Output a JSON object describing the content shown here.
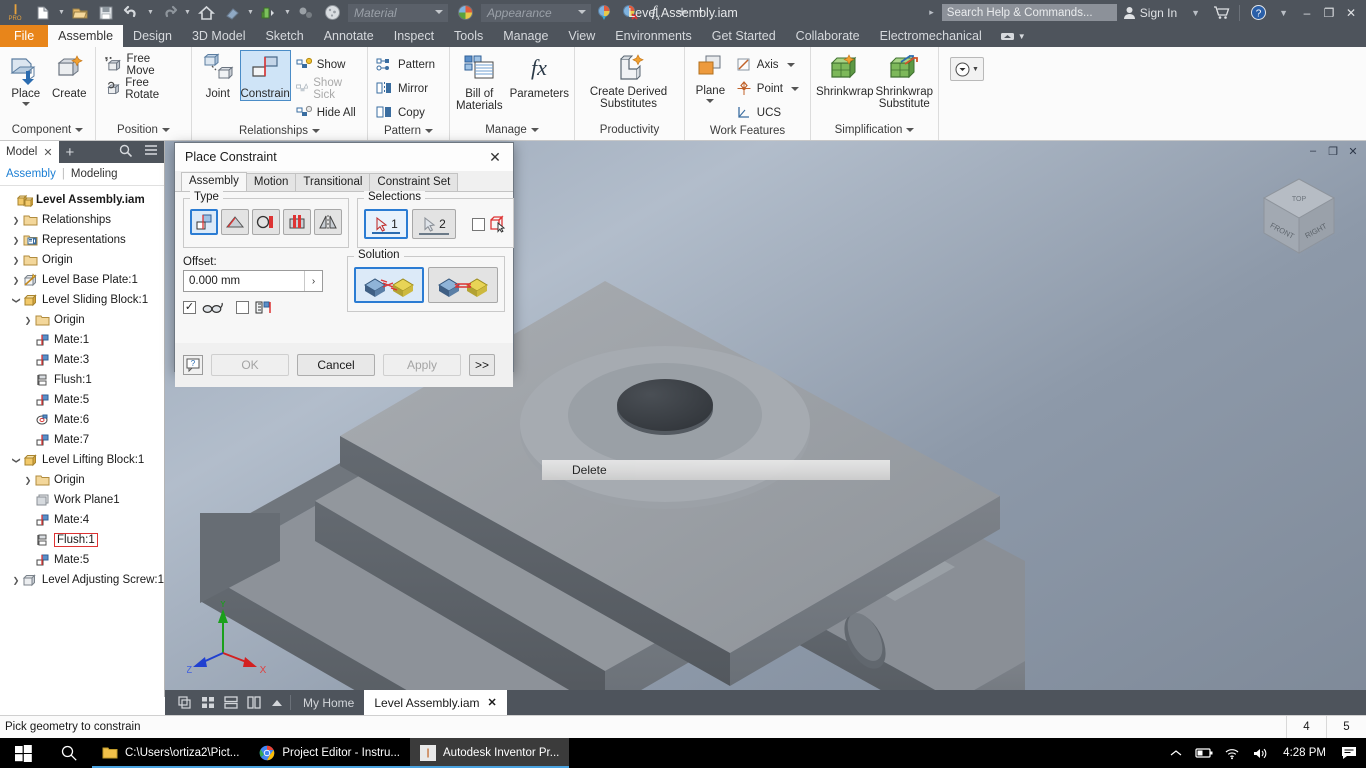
{
  "quick_access": {
    "logo": "I PRO",
    "buttons": [
      {
        "name": "new-file-icon",
        "label": "New"
      },
      {
        "name": "open-file-icon",
        "label": "Open"
      },
      {
        "name": "save-icon",
        "label": "Save"
      },
      {
        "name": "undo-icon",
        "label": "Undo"
      },
      {
        "name": "redo-icon",
        "label": "Redo"
      },
      {
        "name": "home-icon",
        "label": "Home"
      },
      {
        "name": "return-icon",
        "label": "Return"
      },
      {
        "name": "update-icon",
        "label": "Update"
      },
      {
        "name": "select-icon",
        "label": "Select"
      }
    ],
    "material_placeholder": "Material",
    "appearance_placeholder": "Appearance",
    "title": "Level Assembly.iam",
    "search_placeholder": "Search Help & Commands...",
    "sign_in": "Sign In",
    "window": {
      "minimize": "–",
      "restore": "❐",
      "close": "✕"
    }
  },
  "ribbon": {
    "tabs": [
      {
        "label": "File",
        "state": "file"
      },
      {
        "label": "Assemble",
        "state": "active"
      },
      {
        "label": "Design",
        "state": "normal"
      },
      {
        "label": "3D Model",
        "state": "normal"
      },
      {
        "label": "Sketch",
        "state": "normal"
      },
      {
        "label": "Annotate",
        "state": "normal"
      },
      {
        "label": "Inspect",
        "state": "normal"
      },
      {
        "label": "Tools",
        "state": "normal"
      },
      {
        "label": "Manage",
        "state": "normal"
      },
      {
        "label": "View",
        "state": "normal"
      },
      {
        "label": "Environments",
        "state": "normal"
      },
      {
        "label": "Get Started",
        "state": "normal"
      },
      {
        "label": "Collaborate",
        "state": "normal"
      },
      {
        "label": "Electromechanical",
        "state": "normal"
      }
    ],
    "panels": [
      {
        "title": "Component",
        "has_dropdown": true,
        "big_buttons": [
          {
            "label": "Place",
            "icon": "place-component-icon",
            "has_caret": true
          },
          {
            "label": "Create",
            "icon": "create-component-icon",
            "has_caret": false
          }
        ],
        "small_buttons": []
      },
      {
        "title": "Position",
        "has_dropdown": true,
        "big_buttons": [],
        "small_buttons": [
          {
            "label": "Free Move",
            "icon": "free-move-icon",
            "disabled": false
          },
          {
            "label": "Free Rotate",
            "icon": "free-rotate-icon",
            "disabled": false
          }
        ]
      },
      {
        "title": "Relationships",
        "has_dropdown": true,
        "big_buttons": [
          {
            "label": "Joint",
            "icon": "joint-icon",
            "has_caret": false
          },
          {
            "label": "Constrain",
            "icon": "constrain-icon",
            "has_caret": false,
            "selected": true
          }
        ],
        "small_buttons": [
          {
            "label": "Show",
            "icon": "show-relationships-icon",
            "disabled": false
          },
          {
            "label": "Show Sick",
            "icon": "show-sick-icon",
            "disabled": true
          },
          {
            "label": "Hide All",
            "icon": "hide-all-icon",
            "disabled": false
          }
        ]
      },
      {
        "title": "Pattern",
        "has_dropdown": true,
        "big_buttons": [],
        "small_buttons": [
          {
            "label": "Pattern",
            "icon": "pattern-icon",
            "disabled": false
          },
          {
            "label": "Mirror",
            "icon": "mirror-icon",
            "disabled": false
          },
          {
            "label": "Copy",
            "icon": "copy-icon",
            "disabled": false
          }
        ]
      },
      {
        "title": "Manage",
        "has_dropdown": true,
        "big_buttons": [
          {
            "label": "Bill of Materials",
            "icon": "bill-of-materials-icon",
            "has_caret": false
          },
          {
            "label": "Parameters",
            "icon": "parameters-icon",
            "has_caret": false
          }
        ],
        "small_buttons": []
      },
      {
        "title": "Productivity",
        "has_dropdown": false,
        "big_buttons": [
          {
            "label": "Create Derived Substitutes",
            "icon": "create-derived-icon",
            "has_caret": true
          }
        ],
        "small_buttons": []
      },
      {
        "title": "Work Features",
        "has_dropdown": false,
        "big_buttons": [
          {
            "label": "Plane",
            "icon": "work-plane-icon",
            "has_caret": true
          }
        ],
        "small_buttons": [
          {
            "label": "Axis",
            "icon": "work-axis-icon",
            "disabled": false,
            "caret": true
          },
          {
            "label": "Point",
            "icon": "work-point-icon",
            "disabled": false,
            "caret": true
          },
          {
            "label": "UCS",
            "icon": "ucs-icon",
            "disabled": false,
            "caret": false
          }
        ]
      },
      {
        "title": "Simplification",
        "has_dropdown": true,
        "big_buttons": [
          {
            "label": "Shrinkwrap",
            "icon": "shrinkwrap-icon",
            "has_caret": false
          },
          {
            "label": "Shrinkwrap Substitute",
            "icon": "shrinkwrap-substitute-icon",
            "has_caret": false
          }
        ],
        "small_buttons": []
      },
      {
        "title": "",
        "has_dropdown": false,
        "big_buttons": [],
        "small_buttons": [],
        "dropdown_only": true
      }
    ]
  },
  "browser": {
    "tab_label": "Model",
    "tab_close": "✕",
    "add_label": "+",
    "search_icon": "search-icon",
    "menu_icon": "hamburger-menu-icon",
    "sub_tabs": {
      "active": "Assembly",
      "divider": "|",
      "inactive": "Modeling"
    },
    "tree": [
      {
        "label": "Level Assembly.iam",
        "indent": 0,
        "twisty": "none",
        "icon": "assembly-icon",
        "bold": true
      },
      {
        "label": "Relationships",
        "indent": 1,
        "twisty": "right",
        "icon": "folder-icon"
      },
      {
        "label": "Representations",
        "indent": 1,
        "twisty": "right",
        "icon": "representations-icon"
      },
      {
        "label": "Origin",
        "indent": 1,
        "twisty": "right",
        "icon": "folder-icon"
      },
      {
        "label": "Level Base Plate:1",
        "indent": 1,
        "twisty": "right",
        "icon": "part-grounded-icon"
      },
      {
        "label": "Level Sliding Block:1",
        "indent": 1,
        "twisty": "down",
        "icon": "part-icon"
      },
      {
        "label": "Origin",
        "indent": 2,
        "twisty": "right",
        "icon": "folder-icon"
      },
      {
        "label": "Mate:1",
        "indent": 2,
        "twisty": "none",
        "icon": "mate-icon"
      },
      {
        "label": "Mate:3",
        "indent": 2,
        "twisty": "none",
        "icon": "mate-icon"
      },
      {
        "label": "Flush:1",
        "indent": 2,
        "twisty": "none",
        "icon": "flush-icon"
      },
      {
        "label": "Mate:5",
        "indent": 2,
        "twisty": "none",
        "icon": "mate-icon"
      },
      {
        "label": "Mate:6",
        "indent": 2,
        "twisty": "none",
        "icon": "insert-icon"
      },
      {
        "label": "Mate:7",
        "indent": 2,
        "twisty": "none",
        "icon": "mate-icon"
      },
      {
        "label": "Level Lifting Block:1",
        "indent": 1,
        "twisty": "down",
        "icon": "part-icon"
      },
      {
        "label": "Origin",
        "indent": 2,
        "twisty": "right",
        "icon": "folder-icon"
      },
      {
        "label": "Work Plane1",
        "indent": 2,
        "twisty": "none",
        "icon": "work-plane-small-icon"
      },
      {
        "label": "Mate:4",
        "indent": 2,
        "twisty": "none",
        "icon": "mate-icon"
      },
      {
        "label": "Flush:1",
        "indent": 2,
        "twisty": "none",
        "icon": "flush-icon",
        "selected": true
      },
      {
        "label": "Mate:5",
        "indent": 2,
        "twisty": "none",
        "icon": "mate-icon"
      },
      {
        "label": "Level Adjusting Screw:1",
        "indent": 1,
        "twisty": "right",
        "icon": "part-grey-icon"
      }
    ]
  },
  "dialog": {
    "title": "Place Constraint",
    "close": "✕",
    "tabs": [
      {
        "label": "Assembly",
        "active": true
      },
      {
        "label": "Motion",
        "active": false
      },
      {
        "label": "Transitional",
        "active": false
      },
      {
        "label": "Constraint Set",
        "active": false
      }
    ],
    "type_group": {
      "legend": "Type",
      "buttons": [
        {
          "name": "constraint-type-mate",
          "active": true
        },
        {
          "name": "constraint-type-angle",
          "active": false
        },
        {
          "name": "constraint-type-tangent",
          "active": false
        },
        {
          "name": "constraint-type-insert",
          "active": false
        },
        {
          "name": "constraint-type-symmetry",
          "active": false
        }
      ]
    },
    "selections_group": {
      "legend": "Selections",
      "buttons": [
        {
          "name": "selection-1-button",
          "label": "1",
          "active": true
        },
        {
          "name": "selection-2-button",
          "label": "2",
          "active": false
        }
      ],
      "pick_part_first_checked": false
    },
    "offset": {
      "label": "Offset:",
      "value": "0.000 mm",
      "expand_arrow": "›"
    },
    "options": {
      "predict_offset_checked": true,
      "show_preview_checked": false
    },
    "solution_group": {
      "legend": "Solution",
      "buttons": [
        {
          "name": "solution-opposed-button",
          "active": true
        },
        {
          "name": "solution-aligned-button",
          "active": false
        }
      ]
    },
    "footer": {
      "help": "?",
      "ok": "OK",
      "cancel": "Cancel",
      "apply": "Apply",
      "more": ">>"
    }
  },
  "viewport": {
    "window_buttons": {
      "minimize": "–",
      "restore": "❐",
      "close": "✕"
    },
    "view_cube": {
      "front": "FRONT",
      "right": "RIGHT",
      "top": "TOP"
    },
    "axis_labels": {
      "x": "X",
      "y": "Y",
      "z": "Z"
    },
    "context_menu_item": "Delete"
  },
  "doc_tabs": {
    "view_buttons": [
      {
        "name": "tile-cascade-icon"
      },
      {
        "name": "tile-grid-icon"
      },
      {
        "name": "tile-horizontal-icon"
      },
      {
        "name": "tile-vertical-icon"
      },
      {
        "name": "expand-up-icon"
      }
    ],
    "tabs": [
      {
        "label": "My Home",
        "active": false,
        "closable": false
      },
      {
        "label": "Level Assembly.iam",
        "active": true,
        "closable": true,
        "close": "✕"
      }
    ]
  },
  "status_bar": {
    "message": "Pick geometry to constrain",
    "cells": [
      "4",
      "5"
    ]
  },
  "taskbar": {
    "start_icon": "windows-start-icon",
    "search_icon": "taskbar-search-icon",
    "apps": [
      {
        "label": "C:\\Users\\ortiza2\\Pict...",
        "icon": "folder-explorer-icon",
        "active": false
      },
      {
        "label": "Project Editor - Instru...",
        "icon": "chrome-icon",
        "active": false
      },
      {
        "label": "Autodesk Inventor Pr...",
        "icon": "inventor-icon",
        "active": true
      }
    ],
    "tray": {
      "chevron": "⌃",
      "icons": [
        "battery-icon",
        "wifi-icon",
        "volume-icon"
      ],
      "clock": "4:28 PM",
      "notification": "notification-icon"
    }
  },
  "colors": {
    "accent_orange": "#e8851a",
    "ribbon_dark": "#4e545c",
    "selection_blue": "#2b7cd3",
    "tree_link_blue": "#1c7fd4"
  }
}
